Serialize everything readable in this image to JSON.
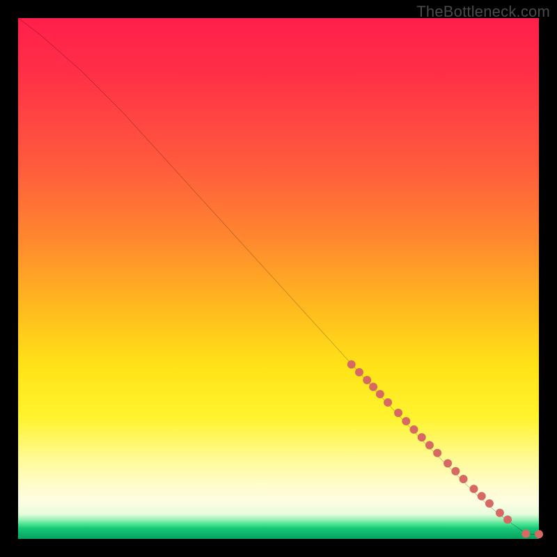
{
  "watermark": "TheBottleneck.com",
  "chart_data": {
    "type": "line",
    "title": "",
    "xlabel": "",
    "ylabel": "",
    "xlim": [
      0,
      100
    ],
    "ylim": [
      0,
      100
    ],
    "grid": false,
    "legend": false,
    "series": [
      {
        "name": "curve",
        "style": "line",
        "color": "#000000",
        "x": [
          0,
          4,
          8,
          12,
          20,
          30,
          40,
          50,
          60,
          70,
          78,
          84,
          88,
          92,
          95,
          97,
          98.5,
          100
        ],
        "y": [
          100,
          97,
          93.5,
          90,
          82,
          71,
          60,
          49,
          38,
          27,
          18.5,
          12.5,
          8.5,
          5,
          2.8,
          1.4,
          0.9,
          0.9
        ]
      },
      {
        "name": "markers",
        "style": "scatter",
        "color": "#d66a63",
        "radius": 6,
        "x": [
          64,
          65.5,
          67,
          68.2,
          69.5,
          71,
          73,
          74.5,
          76,
          77.5,
          79,
          80.5,
          82.5,
          84,
          85.5,
          87.5,
          89,
          90.5,
          92.5,
          94,
          97.5,
          100
        ],
        "y": [
          33.5,
          32,
          30.5,
          29.2,
          27.8,
          26.2,
          24.2,
          22.6,
          21,
          19.5,
          18,
          16.5,
          14.5,
          13,
          11.5,
          9.6,
          8.2,
          6.8,
          5,
          3.7,
          1,
          0.9
        ]
      }
    ],
    "background_gradient": {
      "orientation": "vertical",
      "stops": [
        {
          "pos": 0.0,
          "color": "#ff1f4a"
        },
        {
          "pos": 0.28,
          "color": "#ff5a3d"
        },
        {
          "pos": 0.55,
          "color": "#ffb81f"
        },
        {
          "pos": 0.77,
          "color": "#fff430"
        },
        {
          "pos": 0.92,
          "color": "#fdfde2"
        },
        {
          "pos": 0.975,
          "color": "#17c877"
        },
        {
          "pos": 1.0,
          "color": "#08a35f"
        }
      ]
    }
  }
}
